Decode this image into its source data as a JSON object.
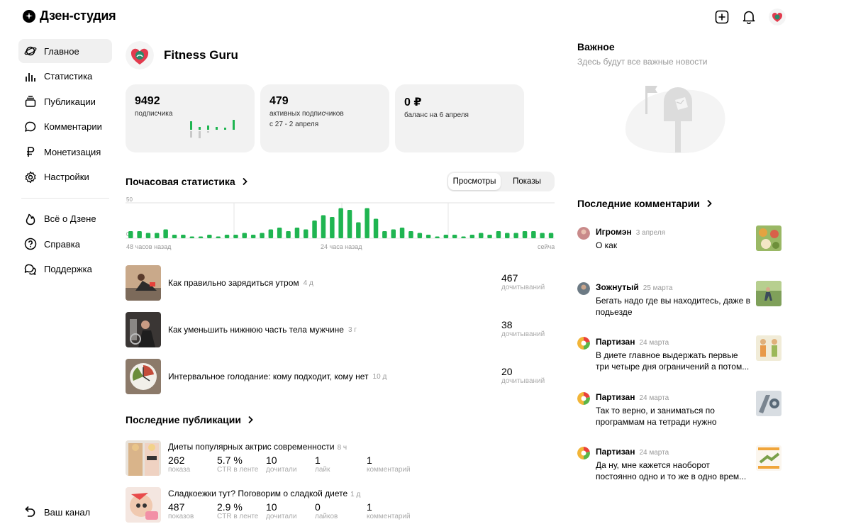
{
  "app": {
    "title": "Дзен-студия"
  },
  "sidebar": {
    "items": [
      {
        "label": "Главное",
        "icon": "planet-icon"
      },
      {
        "label": "Статистика",
        "icon": "bar-chart-icon"
      },
      {
        "label": "Публикации",
        "icon": "stack-icon"
      },
      {
        "label": "Комментарии",
        "icon": "chat-bubble-icon"
      },
      {
        "label": "Монетизация",
        "icon": "ruble-icon"
      },
      {
        "label": "Настройки",
        "icon": "gear-icon"
      }
    ],
    "secondary": [
      {
        "label": "Всё о Дзене",
        "icon": "flame-icon"
      },
      {
        "label": "Справка",
        "icon": "question-icon"
      },
      {
        "label": "Поддержка",
        "icon": "chat-bubbles-icon"
      }
    ],
    "bottom": {
      "label": "Ваш канал",
      "icon": "back-arrow-icon"
    }
  },
  "channel": {
    "name": "Fitness Guru"
  },
  "cards": [
    {
      "value": "9492",
      "label": "подписчика",
      "label2": ""
    },
    {
      "value": "479",
      "label": "активных подписчиков",
      "label2": "с 27 - 2 апреля"
    },
    {
      "value": "0 ₽",
      "label": "баланс на 6 апреля",
      "label2": ""
    }
  ],
  "hourly": {
    "title": "Почасовая статистика",
    "tabs": [
      "Просмотры",
      "Показы"
    ],
    "selected_tab": "Просмотры",
    "chart_data": {
      "type": "bar",
      "ytick": "50",
      "ytick0": "0",
      "xlabels": [
        "48 часов назад",
        "24 часа назад",
        "сейча"
      ],
      "values": [
        4,
        4,
        3,
        3,
        5,
        2,
        2,
        1,
        1,
        2,
        1,
        2,
        2,
        3,
        2,
        3,
        5,
        6,
        4,
        6,
        5,
        10,
        13,
        12,
        17,
        16,
        9,
        17,
        11,
        4,
        5,
        6,
        4,
        3,
        2,
        1,
        2,
        2,
        1,
        2,
        3,
        2,
        4,
        3,
        3,
        4,
        4,
        3,
        3,
        4,
        2,
        3,
        2,
        3,
        5,
        7,
        5,
        6,
        3,
        1
      ]
    }
  },
  "top_articles": [
    {
      "title": "Как правильно зарядиться утром",
      "age": "4 д",
      "reads": "467",
      "reads_label": "дочитываний"
    },
    {
      "title": "Как уменьшить нижнюю часть тела мужчине",
      "age": "3 г",
      "reads": "38",
      "reads_label": "дочитываний"
    },
    {
      "title": "Интервальное голодание: кому подходит, кому нет",
      "age": "10 д",
      "reads": "20",
      "reads_label": "дочитываний"
    }
  ],
  "recent": {
    "title": "Последние публикации",
    "items": [
      {
        "title": "Диеты популярных актрис современности",
        "age": "8 ч",
        "metrics": [
          {
            "v": "262",
            "l": "показа"
          },
          {
            "v": "5.7 %",
            "l": "CTR в ленте"
          },
          {
            "v": "10",
            "l": "дочитали"
          },
          {
            "v": "1",
            "l": "лайк"
          },
          {
            "v": "1",
            "l": "комментарий"
          }
        ]
      },
      {
        "title": "Сладкоежки тут? Поговорим о сладкой диете",
        "age": "1 д",
        "metrics": [
          {
            "v": "487",
            "l": "показов"
          },
          {
            "v": "2.9 %",
            "l": "CTR в ленте"
          },
          {
            "v": "10",
            "l": "дочитали"
          },
          {
            "v": "0",
            "l": "лайков"
          },
          {
            "v": "1",
            "l": "комментарий"
          }
        ]
      }
    ]
  },
  "important": {
    "title": "Важное",
    "subtitle": "Здесь будут все важные новости"
  },
  "comments": {
    "title": "Последние комментарии",
    "items": [
      {
        "author": "Игромэн",
        "date": "3 апреля",
        "text": "О как"
      },
      {
        "author": "Зожнутый",
        "date": "25 марта",
        "text": "Бегать надо где вы находитесь, даже в подьезде"
      },
      {
        "author": "Партизан",
        "date": "24 марта",
        "text": "В диете главное выдержать первые три четыре дня ограничений а потом..."
      },
      {
        "author": "Партизан",
        "date": "24 марта",
        "text": "Так то верно, и заниматься по программам на тетради нужно"
      },
      {
        "author": "Партизан",
        "date": "24 марта",
        "text": "Да ну, мне кажется наоборот постоянно одно и то же в одно врем..."
      }
    ]
  },
  "colors": {
    "accent_green": "#1fb551",
    "light_green": "#8ed9a4",
    "card_bg": "#f2f2f2"
  }
}
